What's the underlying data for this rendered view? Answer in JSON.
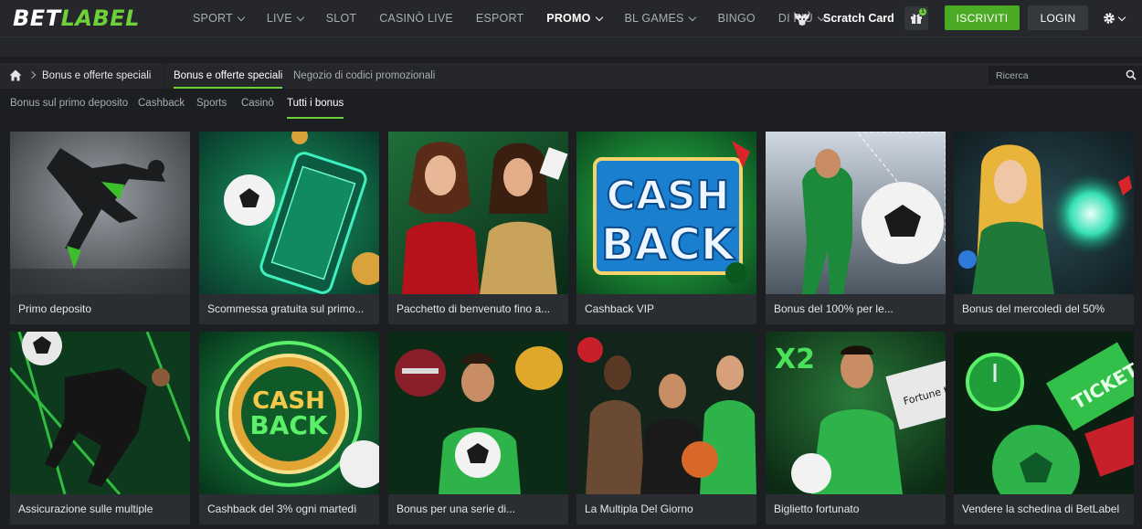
{
  "brand": {
    "logo_main": "BET",
    "logo_accent": "LABEL",
    "accent_color": "#6fd13a",
    "register_color": "#4bab25"
  },
  "header": {
    "nav": [
      {
        "label": "SPORT",
        "dropdown": true
      },
      {
        "label": "LIVE",
        "dropdown": true
      },
      {
        "label": "SLOT",
        "dropdown": false
      },
      {
        "label": "CASINÒ LIVE",
        "dropdown": false
      },
      {
        "label": "ESPORT",
        "dropdown": false
      },
      {
        "label": "PROMO",
        "dropdown": true,
        "active": true
      },
      {
        "label": "BL GAMES",
        "dropdown": true
      },
      {
        "label": "BINGO",
        "dropdown": false
      },
      {
        "label": "DI PIÙ",
        "dropdown": true
      }
    ],
    "scratch_card": "Scratch Card",
    "gift_badge": "1",
    "register_label": "ISCRIVITI",
    "login_label": "LOGIN",
    "settings_icon": "gear-icon"
  },
  "breadcrumb": {
    "home_icon": "home-icon",
    "current": "Bonus e offerte speciali"
  },
  "tabs": [
    {
      "label": "Bonus e offerte speciali",
      "active": true
    },
    {
      "label": "Negozio di codici promozionali",
      "active": false
    }
  ],
  "search": {
    "placeholder": "Ricerca",
    "icon": "search-icon"
  },
  "filters": [
    {
      "label": "Bonus sul primo deposito",
      "active": false
    },
    {
      "label": "Cashback",
      "active": false
    },
    {
      "label": "Sports",
      "active": false
    },
    {
      "label": "Casinò",
      "active": false
    },
    {
      "label": "Tutti i bonus",
      "active": true
    }
  ],
  "cards": [
    {
      "title": "Primo deposito"
    },
    {
      "title": "Scommessa gratuita sul primo..."
    },
    {
      "title": "Pacchetto di benvenuto fino a..."
    },
    {
      "title": "Cashback VIP",
      "art_text_1": "CASH",
      "art_text_2": "BACK"
    },
    {
      "title": "Bonus del 100% per le..."
    },
    {
      "title": "Bonus del mercoledì del 50%"
    },
    {
      "title": "Assicurazione sulle multiple"
    },
    {
      "title": "Cashback del 3% ogni martedì",
      "art_text_1": "CASH",
      "art_text_2": "BACK"
    },
    {
      "title": "Bonus per una serie di..."
    },
    {
      "title": "La Multipla Del Giorno"
    },
    {
      "title": "Biglietto fortunato",
      "art_text_1": "X2",
      "art_text_2": "Fortune ticket"
    },
    {
      "title": "Vendere la schedina di BetLabel",
      "art_text_1": "TICKET"
    }
  ]
}
